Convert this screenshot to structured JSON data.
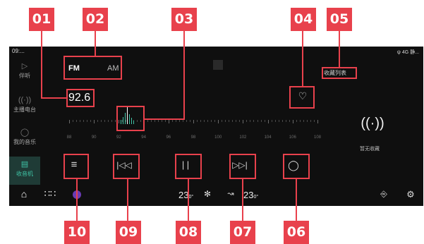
{
  "callouts": [
    "01",
    "02",
    "03",
    "04",
    "05",
    "06",
    "07",
    "08",
    "09",
    "10"
  ],
  "status": {
    "time": "09:...",
    "network": "4G",
    "right_text": "静..."
  },
  "sidebar": {
    "items": [
      {
        "label": "伴听",
        "icon": "play-icon"
      },
      {
        "label": "主播电台",
        "icon": "broadcast-icon"
      },
      {
        "label": "我的音乐",
        "icon": "user-icon"
      },
      {
        "label": "收音机",
        "icon": "radio-icon",
        "active": true
      }
    ]
  },
  "radio": {
    "band_fm": "FM",
    "band_am": "AM",
    "frequency": "92.6",
    "scale_labels": [
      "88",
      "90",
      "92",
      "94",
      "96",
      "98",
      "100",
      "102",
      "104",
      "106",
      "108"
    ],
    "favorites_list_label": "收藏列表",
    "no_favorites_label": "暂无收藏"
  },
  "controls": [
    "list-button",
    "previous-button",
    "pause-button",
    "next-button",
    "scan-button"
  ],
  "bottom_bar": {
    "temp_left": "23",
    "temp_right": "23",
    "temp_decimal": "0",
    "temp_unit": "°"
  },
  "colors": {
    "accent": "#3fc3a5",
    "callout": "#e8414c",
    "screen_bg": "#0f0f0f"
  }
}
